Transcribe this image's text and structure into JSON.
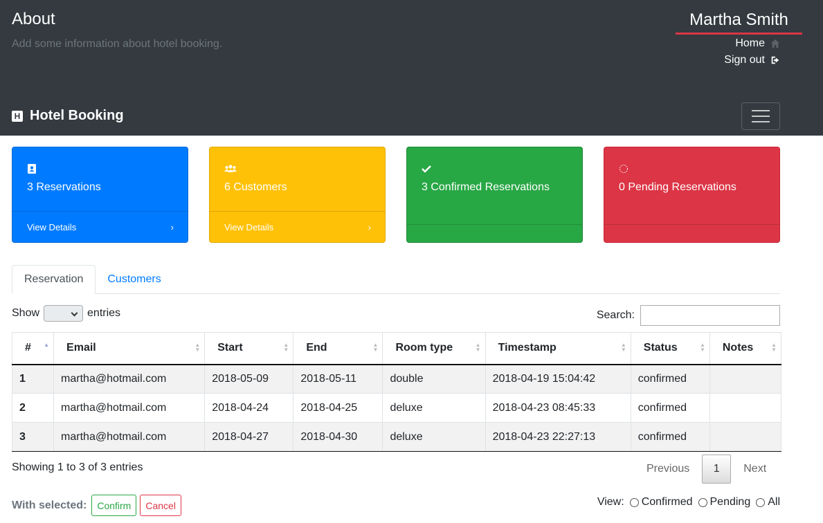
{
  "header": {
    "title": "About",
    "subtitle": "Add some information about hotel booking.",
    "user_name": "Martha Smith",
    "home_label": "Home",
    "signout_label": "Sign out",
    "brand": "Hotel Booking",
    "brand_icon_letter": "H"
  },
  "cards": [
    {
      "label": "3 Reservations",
      "footer": "View Details",
      "icon": "address-book-icon",
      "color": "#007bff"
    },
    {
      "label": "6 Customers",
      "footer": "View Details",
      "icon": "users-icon",
      "color": "#ffc107"
    },
    {
      "label": "3 Confirmed Reservations",
      "footer": "",
      "icon": "check-icon",
      "color": "#28a745"
    },
    {
      "label": "0 Pending Reservations",
      "footer": "",
      "icon": "spinner-icon",
      "color": "#dc3545"
    }
  ],
  "tabs": [
    {
      "label": "Reservation",
      "active": true
    },
    {
      "label": "Customers",
      "active": false
    }
  ],
  "controls": {
    "show_label": "Show",
    "entries_label": "entries",
    "search_label": "Search:"
  },
  "table": {
    "columns": [
      "#",
      "Email",
      "Start",
      "End",
      "Room type",
      "Timestamp",
      "Status",
      "Notes"
    ],
    "rows": [
      [
        "1",
        "martha@hotmail.com",
        "2018-05-09",
        "2018-05-11",
        "double",
        "2018-04-19 15:04:42",
        "confirmed",
        ""
      ],
      [
        "2",
        "martha@hotmail.com",
        "2018-04-24",
        "2018-04-25",
        "deluxe",
        "2018-04-23 08:45:33",
        "confirmed",
        ""
      ],
      [
        "3",
        "martha@hotmail.com",
        "2018-04-27",
        "2018-04-30",
        "deluxe",
        "2018-04-23 22:27:13",
        "confirmed",
        ""
      ]
    ]
  },
  "footer": {
    "showing": "Showing 1 to 3 of 3 entries",
    "previous": "Previous",
    "page": "1",
    "next": "Next",
    "with_selected": "With selected:",
    "confirm": "Confirm",
    "cancel": "Cancel",
    "view_label": "View:",
    "view_options": [
      "Confirmed",
      "Pending",
      "All"
    ]
  }
}
